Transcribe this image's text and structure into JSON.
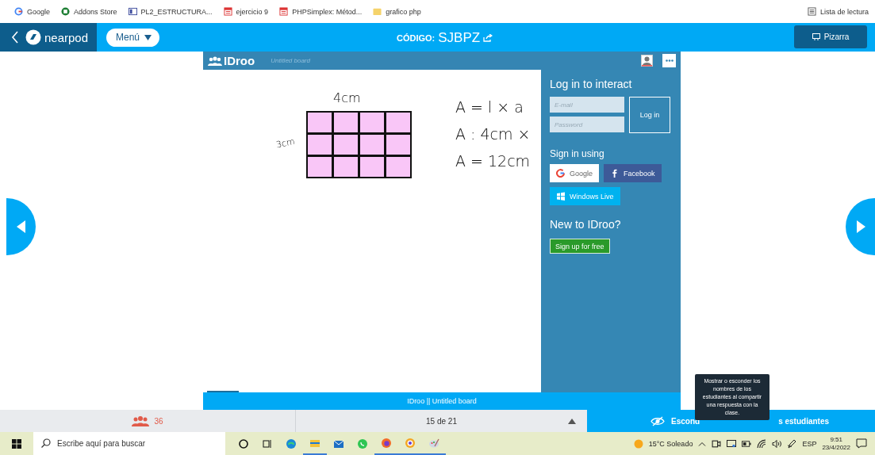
{
  "bookmarks": [
    {
      "label": "Google",
      "kind": "google"
    },
    {
      "label": "Addons Store",
      "kind": "addons"
    },
    {
      "label": "PL2_ESTRUCTURA...",
      "kind": "doc"
    },
    {
      "label": "ejercicio 9",
      "kind": "calc"
    },
    {
      "label": "PHPSimplex: Métod...",
      "kind": "calc"
    },
    {
      "label": "grafico php",
      "kind": "folder"
    }
  ],
  "reading_list": "Lista de lectura",
  "header": {
    "brand": "nearpod",
    "menu": "Menú",
    "code_label": "CÓDIGO:",
    "code": "SJBPZ",
    "whiteboard_button": "Pizarra"
  },
  "board": {
    "app": "IDroo",
    "title": "Untitled board",
    "sketch": {
      "top_label": "4cm",
      "side_label": "3cm",
      "lines": [
        "A = l × a",
        "A : 4cm ×",
        "A = 12cm"
      ]
    },
    "login": {
      "heading": "Log in to interact",
      "email_placeholder": "E-mail",
      "password_placeholder": "Password",
      "login_button": "Log in",
      "sign_in_heading": "Sign in using",
      "providers": [
        {
          "kind": "google",
          "label": "Google"
        },
        {
          "kind": "facebook",
          "label": "Facebook"
        },
        {
          "kind": "windows",
          "label": "Windows Live"
        }
      ],
      "new_heading": "New to IDroo?",
      "signup_button": "Sign up for free"
    },
    "footer": "IDroo || Untitled board"
  },
  "bottom_bar": {
    "participants": "36",
    "slide": "15 de 21",
    "names_toggle": [
      "Escond",
      "s estudiantes"
    ],
    "tooltip": "Mostrar o esconder los nombres de los estudiantes al compartir una respuesta con la clase."
  },
  "taskbar": {
    "search_placeholder": "Escribe aquí para buscar",
    "apps": [
      {
        "kind": "cortana",
        "running": false
      },
      {
        "kind": "taskview",
        "running": false
      },
      {
        "kind": "edge",
        "running": false
      },
      {
        "kind": "explorer",
        "running": true
      },
      {
        "kind": "mail",
        "running": false
      },
      {
        "kind": "whatsapp",
        "running": false
      },
      {
        "kind": "firefox",
        "running": true
      },
      {
        "kind": "browser",
        "running": true
      },
      {
        "kind": "paint",
        "running": true
      }
    ],
    "weather": "15°C  Soleado",
    "language": "ESP",
    "time": "9:51",
    "date": "23/4/2022"
  }
}
